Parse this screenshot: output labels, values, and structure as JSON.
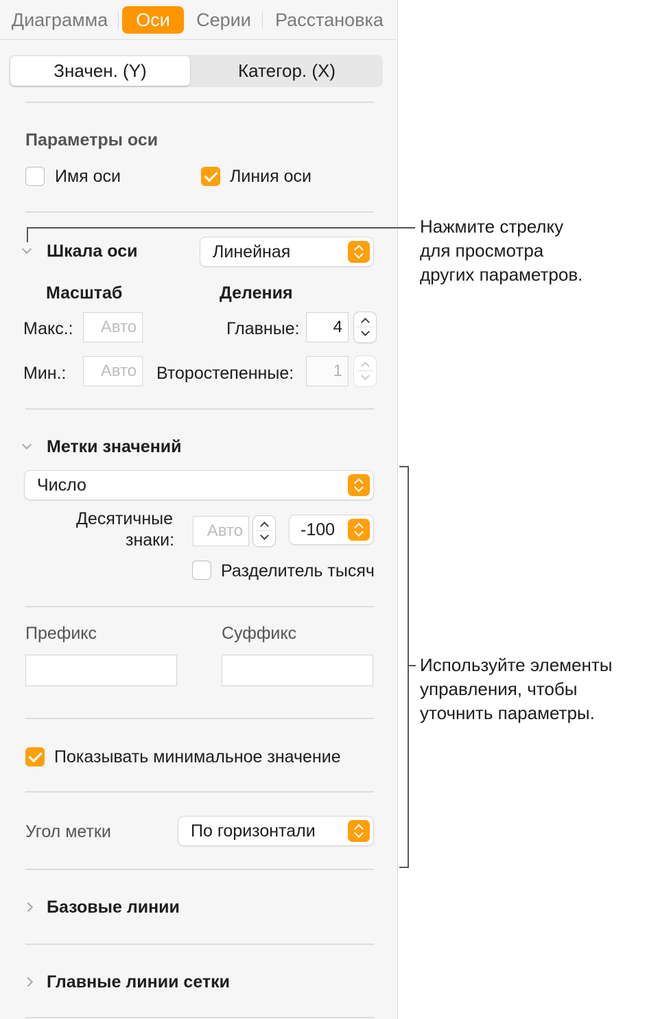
{
  "tabs": [
    "Диаграмма",
    "Оси",
    "Серии",
    "Расстановка"
  ],
  "active_tab": "Оси",
  "axis_selector": {
    "value_y": "Значен. (Y)",
    "category_x": "Категор. (X)"
  },
  "axis_params": {
    "title": "Параметры оси",
    "axis_name": {
      "label": "Имя оси",
      "checked": false
    },
    "axis_line": {
      "label": "Линия оси",
      "checked": true
    }
  },
  "axis_scale": {
    "title": "Шкала оси",
    "scale_type": "Линейная",
    "scale_heading": "Масштаб",
    "ticks_heading": "Деления",
    "max_label": "Макс.:",
    "max_placeholder": "Авто",
    "min_label": "Мин.:",
    "min_placeholder": "Авто",
    "major_label": "Главные:",
    "major_value": "4",
    "minor_label": "Второстепенные:",
    "minor_value": "1"
  },
  "value_labels": {
    "title": "Метки значений",
    "format": "Число",
    "decimals_label_line1": "Десятичные",
    "decimals_label_line2": "знаки:",
    "decimals_placeholder": "Авто",
    "negative_format": "-100",
    "thousands_separator": {
      "label": "Разделитель тысяч",
      "checked": false
    },
    "prefix_label": "Префикс",
    "suffix_label": "Суффикс",
    "show_min": {
      "label": "Показывать минимальное значение",
      "checked": true
    },
    "label_angle_label": "Угол метки",
    "label_angle_value": "По горизонтали"
  },
  "sections": {
    "baselines": "Базовые линии",
    "major_gridlines": "Главные линии сетки"
  },
  "callouts": {
    "arrow": "Нажмите стрелку\nдля просмотра\nдругих параметров.",
    "controls": "Используйте элементы\nуправления, чтобы\nуточнить параметры."
  },
  "colors": {
    "accent": "#ff9500",
    "panel_bg": "#f6f6f6"
  }
}
